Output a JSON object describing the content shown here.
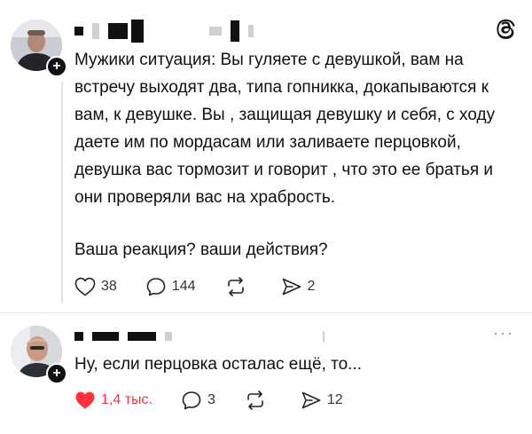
{
  "post1": {
    "text": "Мужики ситуация: Вы гуляете с девушкой, вам на встречу выходят два, типа гопникка, докапываются к вам, к девушке. Вы , защищая девушку и себя, с ходу даете им по мордасам или заливаете перцовкой, девушка вас тормозит и говорит , что это ее братья и они проверяли вас на храбрость.",
    "question": "Ваша реакция? ваши действия?",
    "likes": "38",
    "replies": "144",
    "reposts": "",
    "shares": "2",
    "follow_symbol": "+"
  },
  "post2": {
    "text": "Ну, если перцовка осталас ещё, то...",
    "likes": "1,4 тыс.",
    "replies": "3",
    "reposts": "",
    "shares": "12",
    "follow_symbol": "+",
    "more": "···"
  },
  "icons": {
    "app_logo": "threads-logo-icon",
    "like": "heart-icon",
    "reply": "comment-bubble-icon",
    "repost": "repost-arrows-icon",
    "share": "send-icon",
    "follow": "plus-icon"
  },
  "colors": {
    "liked": "#ff3040",
    "text": "#111111",
    "muted": "#333333"
  }
}
